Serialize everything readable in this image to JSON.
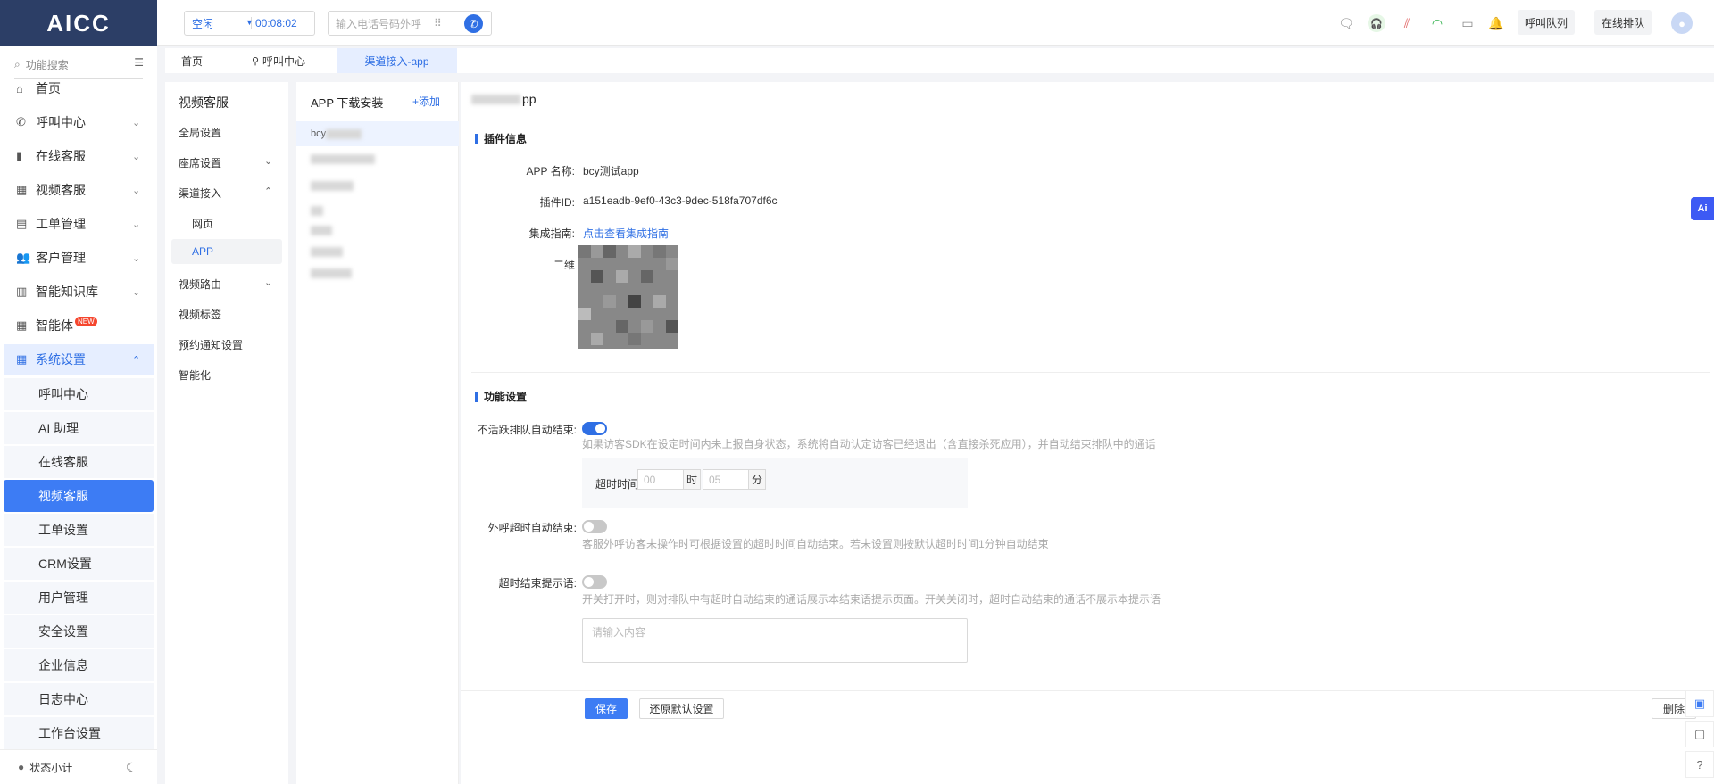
{
  "brand": {
    "logo": "AICC"
  },
  "header": {
    "status": "空闲",
    "timer": "00:08:02",
    "phone_placeholder": "输入电话号码外呼",
    "call_queue_label": "呼叫队列",
    "online_queue_label": "在线排队"
  },
  "sidebar": {
    "search_placeholder": "功能搜索",
    "items": [
      {
        "label": "首页",
        "icon": "home-icon"
      },
      {
        "label": "呼叫中心",
        "icon": "phone-icon"
      },
      {
        "label": "在线客服",
        "icon": "chat-icon"
      },
      {
        "label": "视频客服",
        "icon": "grid-icon"
      },
      {
        "label": "工单管理",
        "icon": "clipboard-icon"
      },
      {
        "label": "客户管理",
        "icon": "users-icon"
      },
      {
        "label": "智能知识库",
        "icon": "library-icon"
      },
      {
        "label": "智能体",
        "icon": "apps-icon",
        "badge": "NEW"
      },
      {
        "label": "系统设置",
        "icon": "settings-grid-icon"
      }
    ],
    "sub_items": [
      "呼叫中心",
      "AI 助理",
      "在线客服",
      "视频客服",
      "工单设置",
      "CRM设置",
      "用户管理",
      "安全设置",
      "企业信息",
      "日志中心",
      "工作台设置"
    ],
    "status_label": "状态小计"
  },
  "tabs": [
    "首页",
    "呼叫中心",
    "渠道接入-app"
  ],
  "col1": {
    "title": "视频客服",
    "items": [
      "全局设置",
      "座席设置",
      "渠道接入",
      "网页",
      "APP",
      "视频路由",
      "视频标签",
      "预约通知设置",
      "智能化"
    ]
  },
  "col2": {
    "header": "APP 下载安装",
    "add": "+添加",
    "first_item": "bcy"
  },
  "main": {
    "title_suffix": "pp",
    "plugin_section": "插件信息",
    "app_name_label": "APP 名称:",
    "app_name": "bcy测试app",
    "plugin_id_label": "插件ID:",
    "plugin_id": "a151eadb-9ef0-43c3-9dec-518fa707df6c",
    "guide_label": "集成指南:",
    "guide_link": "点击查看集成指南",
    "qr_label": "二维",
    "feature_section": "功能设置",
    "inactive_label": "不活跃排队自动结束:",
    "inactive_hint": "如果访客SDK在设定时间内未上报自身状态，系统将自动认定访客已经退出（含直接杀死应用），并自动结束排队中的通话",
    "timeout_label": "超时时间:",
    "hour_placeholder": "00",
    "hour_unit": "时",
    "min_placeholder": "05",
    "min_unit": "分",
    "outbound_label": "外呼超时自动结束:",
    "outbound_hint": "客服外呼访客未操作时可根据设置的超时时间自动结束。若未设置则按默认超时时间1分钟自动结束",
    "end_tip_label": "超时结束提示语:",
    "end_tip_hint": "开关打开时，则对排队中有超时自动结束的通话展示本结束语提示页面。开关关闭时，超时自动结束的通话不展示本提示语",
    "textarea_placeholder": "请输入内容",
    "save": "保存",
    "reset": "还原默认设置",
    "delete": "删除"
  },
  "float": {
    "ai": "Ai"
  }
}
